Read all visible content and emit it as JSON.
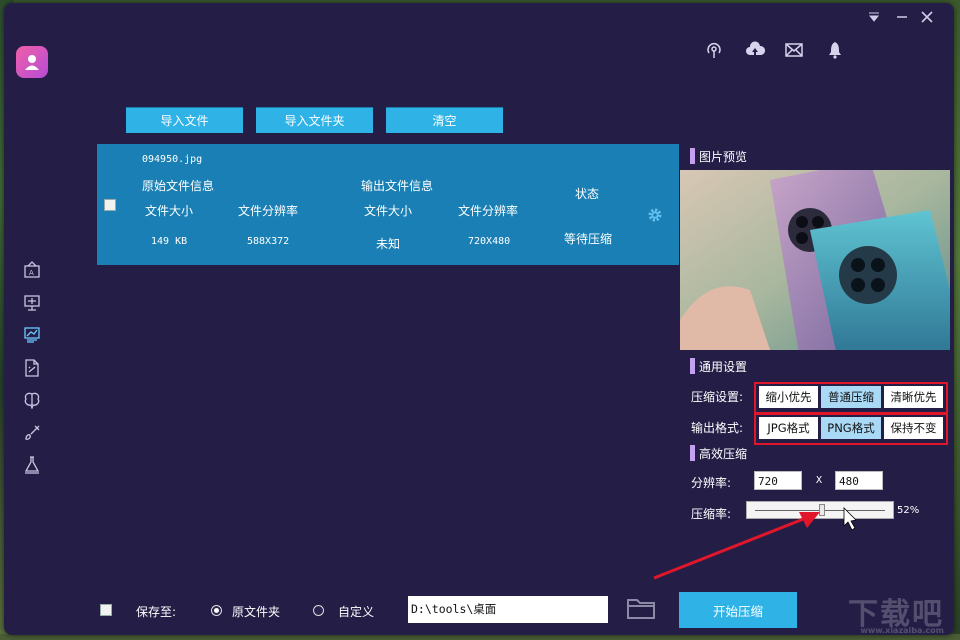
{
  "toolbar": {
    "import_files": "导入文件",
    "import_folder": "导入文件夹",
    "clear": "清空"
  },
  "file_table": {
    "filename": "094950.jpg",
    "original_info_label": "原始文件信息",
    "output_info_label": "输出文件信息",
    "status_header": "状态",
    "file_size_header": "文件大小",
    "resolution_header": "文件分辨率",
    "original_size": "149 KB",
    "original_resolution": "588X372",
    "output_size": "未知",
    "output_resolution": "720X480",
    "status": "等待压缩"
  },
  "preview": {
    "title": "图片预览"
  },
  "settings": {
    "title": "通用设置",
    "compression_label": "压缩设置:",
    "compression_options": [
      "缩小优先",
      "普通压缩",
      "清晰优先"
    ],
    "compression_selected": "普通压缩",
    "format_label": "输出格式:",
    "format_options": [
      "JPG格式",
      "PNG格式",
      "保持不变"
    ],
    "format_selected": "PNG格式"
  },
  "advanced": {
    "title": "高效压缩",
    "resolution_label": "分辨率:",
    "width": "720",
    "x_sep": "X",
    "height": "480",
    "ratio_label": "压缩率:",
    "ratio_value": "52%",
    "ratio_fraction": 0.52
  },
  "bottom": {
    "save_to_label": "保存至:",
    "original_folder": "原文件夹",
    "custom": "自定义",
    "path": "D:\\tools\\桌面",
    "start_button": "开始压缩"
  },
  "watermark": {
    "main": "下载吧",
    "sub": "www.xiazaiba.com"
  },
  "colors": {
    "window_bg": "#241e47",
    "accent": "#2fb3e6",
    "row_selected": "#1a7fb4",
    "highlight_box": "#e0162b",
    "option_selected": "#a9d9f5"
  },
  "icons": {
    "window": [
      "dropdown-icon",
      "minimize-icon",
      "close-icon"
    ],
    "top": [
      "broadcast-icon",
      "cloud-upload-icon",
      "mail-icon",
      "bell-icon"
    ],
    "sidebar": [
      "image-compress-icon",
      "video-compress-icon",
      "chart-icon",
      "pdf-icon",
      "brain-icon",
      "brush-icon",
      "flask-icon"
    ],
    "row_settings": "gear-icon",
    "browse": "folder-icon"
  }
}
